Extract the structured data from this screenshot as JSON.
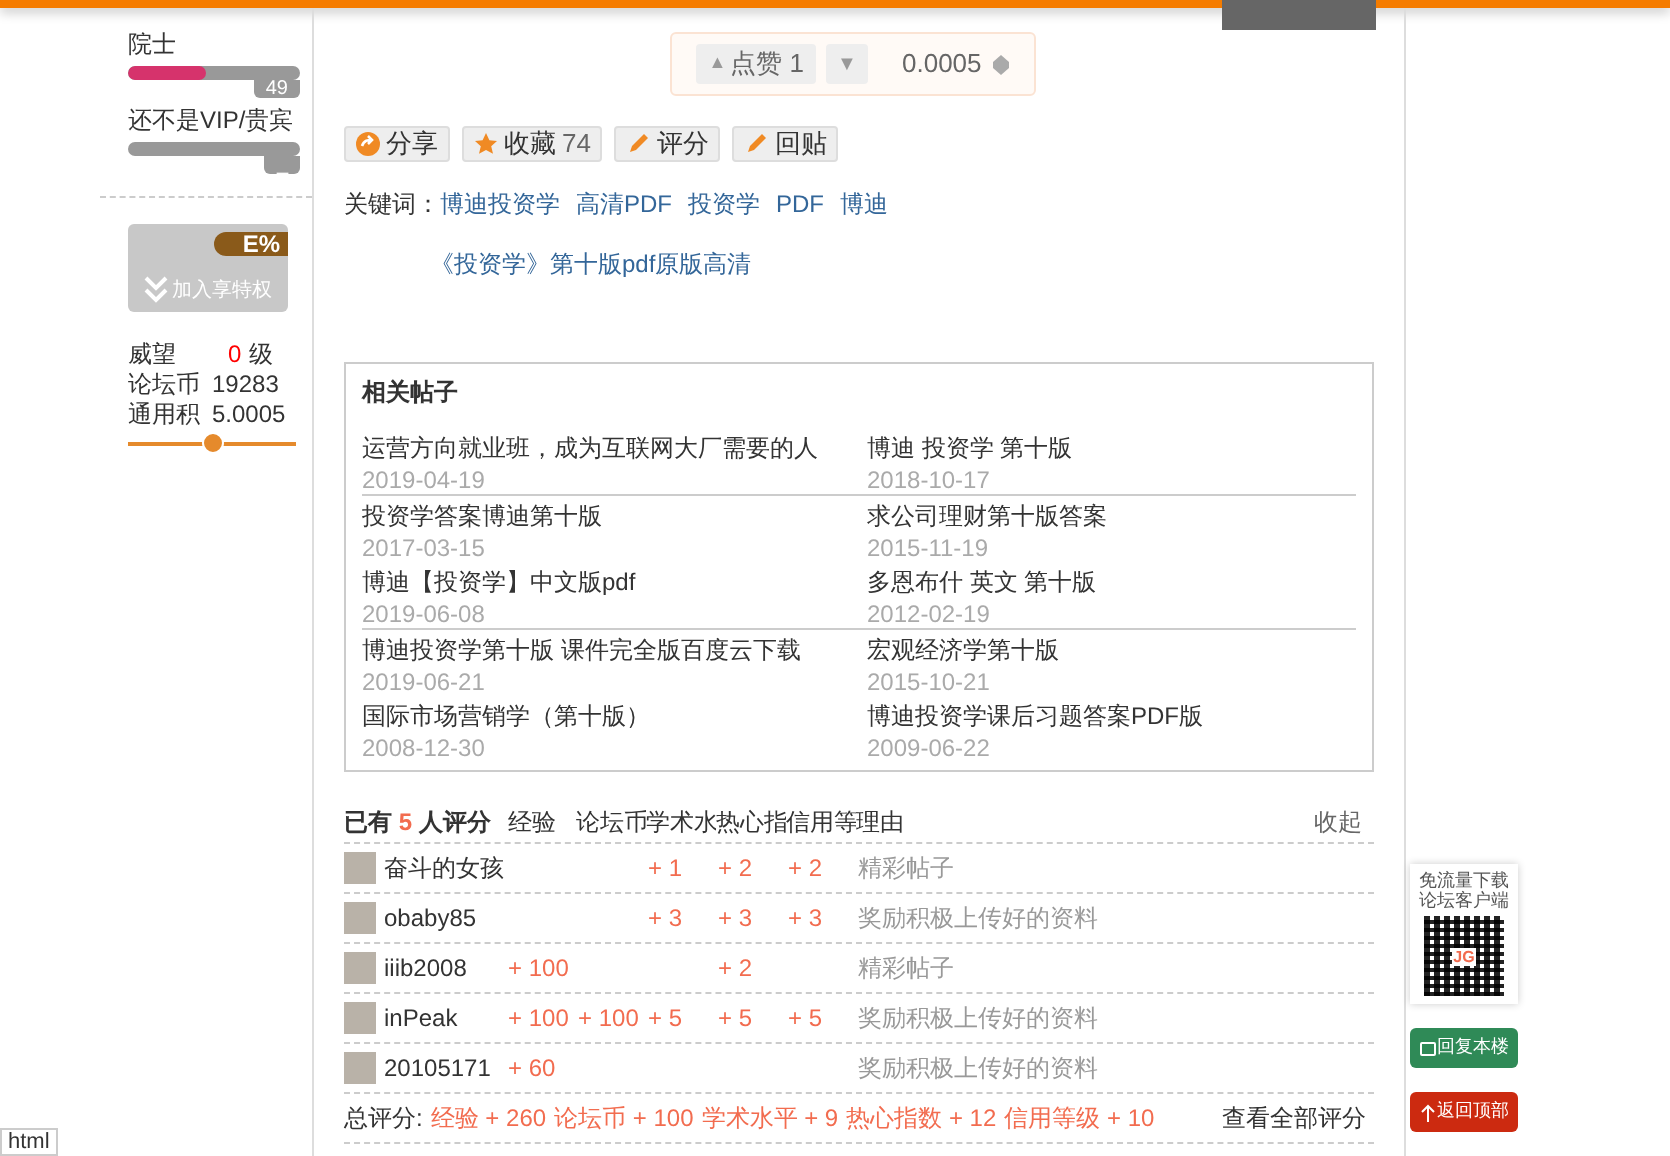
{
  "sidebar": {
    "levels": [
      {
        "label": "院士",
        "level": 0.45,
        "reading": "49"
      },
      {
        "label": "还不是VIP/贵宾",
        "level": 0,
        "reading": "_"
      }
    ],
    "vip_banner": {
      "badge": "E%",
      "text": "加入享特权"
    },
    "stats": [
      {
        "label": "威望",
        "value": "0",
        "unit": "级"
      },
      {
        "label": "论坛币",
        "value": "19283"
      },
      {
        "label": "通用积",
        "value": "5.0005"
      }
    ]
  },
  "vote": {
    "up_icon": "▲",
    "up": "点赞 1",
    "down": "▼",
    "amount": "0.0005"
  },
  "actions": [
    {
      "kind": "share",
      "label": "分享"
    },
    {
      "kind": "favorite",
      "label": "收藏",
      "count": "74"
    },
    {
      "kind": "rate",
      "label": "评分"
    },
    {
      "kind": "reply",
      "label": "回贴"
    }
  ],
  "keywords": {
    "label": "关键词：",
    "items": [
      "博迪投资学",
      "高清PDF",
      "投资学",
      "PDF",
      "博迪"
    ]
  },
  "title_link": "《投资学》第十版pdf原版高清",
  "related": {
    "title": "相关帖子",
    "posts": [
      {
        "title": "运营方向就业班，成为互联网大厂需要的人",
        "date": "2019-04-19"
      },
      {
        "title": "博迪 投资学 第十版",
        "date": "2018-10-17"
      },
      {
        "title": "投资学答案博迪第十版",
        "date": "2017-03-15"
      },
      {
        "title": "求公司理财第十版答案",
        "date": "2015-11-19"
      },
      {
        "title": "博迪【投资学】中文版pdf",
        "date": "2019-06-08"
      },
      {
        "title": "多恩布什 英文 第十版",
        "date": "2012-02-19"
      },
      {
        "title": "博迪投资学第十版 课件完全版百度云下载",
        "date": "2019-06-21"
      },
      {
        "title": "宏观经济学第十版",
        "date": "2015-10-21"
      },
      {
        "title": "国际市场营销学（第十版）",
        "date": "2008-12-30"
      },
      {
        "title": "博迪投资学课后习题答案PDF版",
        "date": "2009-06-22"
      }
    ]
  },
  "ratings": {
    "prefix": "已有",
    "count": "5",
    "suffix": "人评分",
    "columns": [
      "经验",
      "论坛币",
      "学术水",
      "热心指",
      "信用等",
      "理由"
    ],
    "collapse": "收起",
    "rows": [
      {
        "user": "奋斗的女孩",
        "academic": "+ 1",
        "helpful": "+ 2",
        "credit": "+ 2",
        "reason": "精彩帖子"
      },
      {
        "user": "obaby85",
        "academic": "+ 3",
        "helpful": "+ 3",
        "credit": "+ 3",
        "reason": "奖励积极上传好的资料"
      },
      {
        "user": "iiib2008",
        "experience": "+ 100",
        "helpful": "+ 2",
        "reason": "精彩帖子"
      },
      {
        "user": "inPeak",
        "experience": "+ 100",
        "coins": "+ 100",
        "academic": "+ 5",
        "helpful": "+ 5",
        "credit": "+ 5",
        "reason": "奖励积极上传好的资料"
      },
      {
        "user": "20105171",
        "experience": "+ 60",
        "reason": "奖励积极上传好的资料"
      }
    ],
    "total_label": "总评分:",
    "totals": [
      {
        "name": "经验",
        "value": "+ 260"
      },
      {
        "name": "论坛币",
        "value": "+ 100"
      },
      {
        "name": "学术水平",
        "value": "+ 9"
      },
      {
        "name": "热心指数",
        "value": "+ 12"
      },
      {
        "name": "信用等级",
        "value": "+ 10"
      }
    ],
    "view_all": "查看全部评分"
  },
  "floating": {
    "qr_caption": [
      "免流量下载",
      "论坛客户端"
    ],
    "qr_logo": "JG",
    "buttons": [
      {
        "kind": "reply",
        "label": "回复本楼"
      },
      {
        "kind": "top",
        "label": "返回顶部"
      }
    ]
  },
  "corner_tag": "html"
}
